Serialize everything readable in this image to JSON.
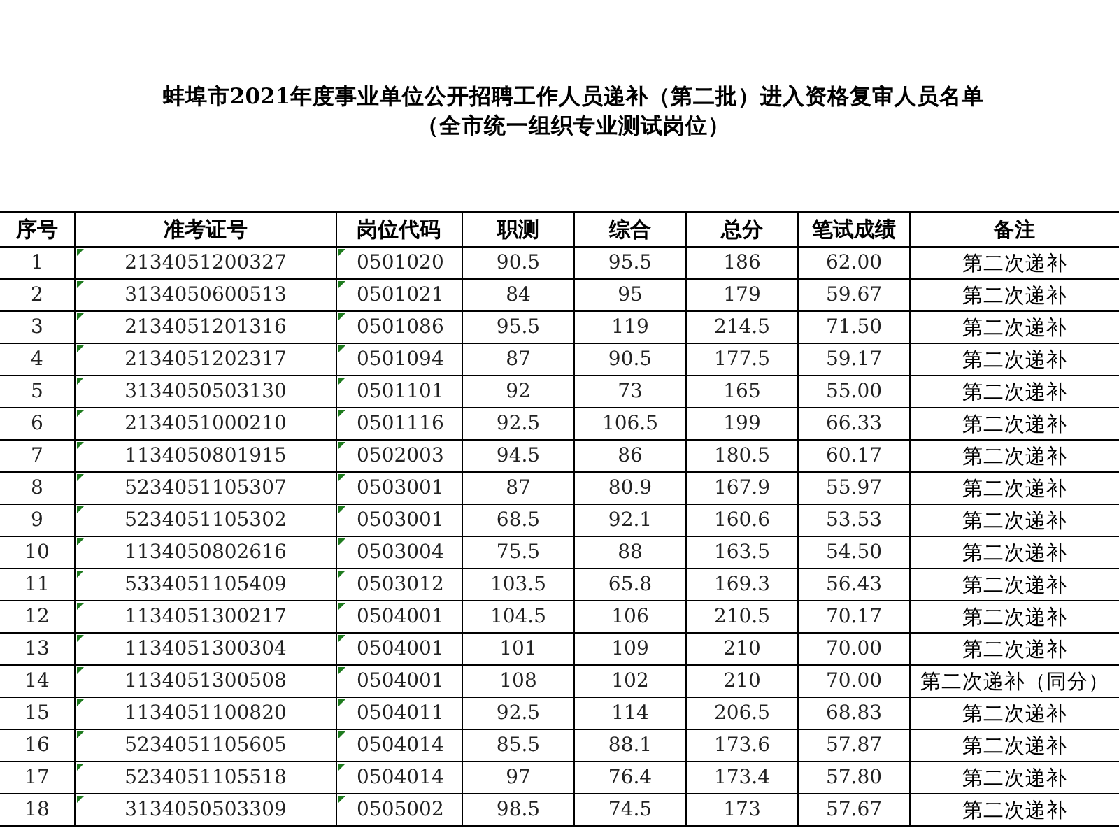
{
  "title": [
    "蚌埠市2021年度事业单位公开招聘工作人员递补（第二批）进入资格复审人员名单",
    "（全市统一组织专业测试岗位）"
  ],
  "table": {
    "columns": [
      {
        "label": "序号"
      },
      {
        "label": "准考证号",
        "flagged": true
      },
      {
        "label": "岗位代码",
        "flagged": true
      },
      {
        "label": "职测"
      },
      {
        "label": "综合"
      },
      {
        "label": "总分"
      },
      {
        "label": "笔试成绩"
      },
      {
        "label": "备注"
      }
    ],
    "rows": [
      [
        "1",
        "2134051200327",
        "0501020",
        "90.5",
        "95.5",
        "186",
        "62.00",
        "第二次递补"
      ],
      [
        "2",
        "3134050600513",
        "0501021",
        "84",
        "95",
        "179",
        "59.67",
        "第二次递补"
      ],
      [
        "3",
        "2134051201316",
        "0501086",
        "95.5",
        "119",
        "214.5",
        "71.50",
        "第二次递补"
      ],
      [
        "4",
        "2134051202317",
        "0501094",
        "87",
        "90.5",
        "177.5",
        "59.17",
        "第二次递补"
      ],
      [
        "5",
        "3134050503130",
        "0501101",
        "92",
        "73",
        "165",
        "55.00",
        "第二次递补"
      ],
      [
        "6",
        "2134051000210",
        "0501116",
        "92.5",
        "106.5",
        "199",
        "66.33",
        "第二次递补"
      ],
      [
        "7",
        "1134050801915",
        "0502003",
        "94.5",
        "86",
        "180.5",
        "60.17",
        "第二次递补"
      ],
      [
        "8",
        "5234051105307",
        "0503001",
        "87",
        "80.9",
        "167.9",
        "55.97",
        "第二次递补"
      ],
      [
        "9",
        "5234051105302",
        "0503001",
        "68.5",
        "92.1",
        "160.6",
        "53.53",
        "第二次递补"
      ],
      [
        "10",
        "1134050802616",
        "0503004",
        "75.5",
        "88",
        "163.5",
        "54.50",
        "第二次递补"
      ],
      [
        "11",
        "5334051105409",
        "0503012",
        "103.5",
        "65.8",
        "169.3",
        "56.43",
        "第二次递补"
      ],
      [
        "12",
        "1134051300217",
        "0504001",
        "104.5",
        "106",
        "210.5",
        "70.17",
        "第二次递补"
      ],
      [
        "13",
        "1134051300304",
        "0504001",
        "101",
        "109",
        "210",
        "70.00",
        "第二次递补"
      ],
      [
        "14",
        "1134051300508",
        "0504001",
        "108",
        "102",
        "210",
        "70.00",
        "第二次递补（同分）"
      ],
      [
        "15",
        "1134051100820",
        "0504011",
        "92.5",
        "114",
        "206.5",
        "68.83",
        "第二次递补"
      ],
      [
        "16",
        "5234051105605",
        "0504014",
        "85.5",
        "88.1",
        "173.6",
        "57.87",
        "第二次递补"
      ],
      [
        "17",
        "5234051105518",
        "0504014",
        "97",
        "76.4",
        "173.4",
        "57.80",
        "第二次递补"
      ],
      [
        "18",
        "3134050503309",
        "0505002",
        "98.5",
        "74.5",
        "173",
        "57.67",
        "第二次递补"
      ]
    ]
  }
}
